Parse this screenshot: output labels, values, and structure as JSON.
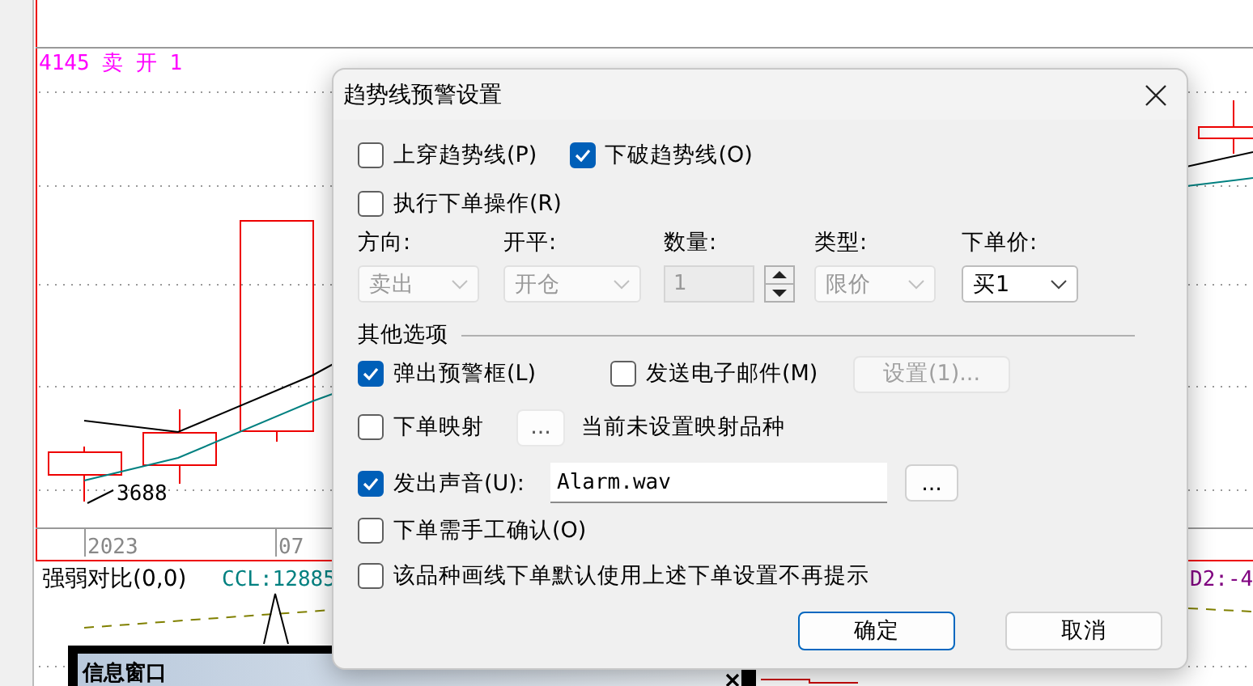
{
  "chart": {
    "order_label": "4145 卖 开 1",
    "low_label": "3688",
    "x_labels": [
      "2023",
      "07"
    ],
    "indicator": {
      "name": "强弱对比(0,0)",
      "ccl": "CCL:12885",
      "d2": "D2:-4"
    },
    "info_window": {
      "title": "信息窗口"
    }
  },
  "dialog": {
    "title": "趋势线预警设置",
    "trend_options": [
      {
        "label": "上穿趋势线(P)",
        "checked": false
      },
      {
        "label": "下破趋势线(O)",
        "checked": true
      }
    ],
    "execute_order": {
      "label": "执行下单操作(R)",
      "checked": false
    },
    "order_fields": [
      {
        "label": "方向:",
        "kind": "dropdown",
        "value": "卖出",
        "disabled": true
      },
      {
        "label": "开平:",
        "kind": "dropdown",
        "value": "开仓",
        "disabled": true
      },
      {
        "label": "数量:",
        "kind": "spinner",
        "value": "1",
        "disabled": true
      },
      {
        "label": "类型:",
        "kind": "dropdown",
        "value": "限价",
        "disabled": true
      },
      {
        "label": "下单价:",
        "kind": "dropdown",
        "value": "买1",
        "disabled": false
      }
    ],
    "other_options_heading": "其他选项",
    "popup_alert": {
      "label": "弹出预警框(L)",
      "checked": true
    },
    "send_email": {
      "label": "发送电子邮件(M)",
      "checked": false
    },
    "email_settings_button": {
      "label": "设置(1)...",
      "disabled": true
    },
    "order_mapping": {
      "label": "下单映射",
      "checked": false,
      "button": "...",
      "status": "当前未设置映射品种"
    },
    "play_sound": {
      "label": "发出声音(U):",
      "checked": true,
      "value": "Alarm.wav",
      "browse_button": "..."
    },
    "manual_confirm": {
      "label": "下单需手工确认(O)",
      "checked": false
    },
    "no_prompt": {
      "label": "该品种画线下单默认使用上述下单设置不再提示",
      "checked": false
    },
    "buttons": [
      {
        "label": "确定",
        "kind": "default"
      },
      {
        "label": "取消",
        "kind": "normal"
      }
    ]
  }
}
